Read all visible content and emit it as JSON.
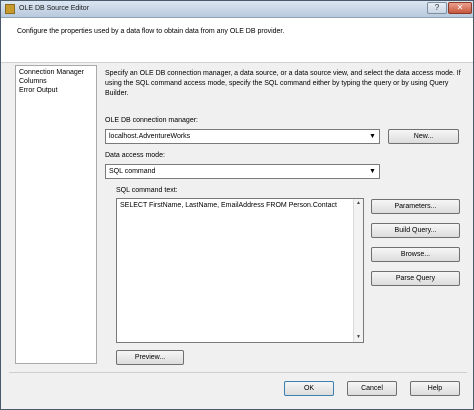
{
  "window": {
    "title": "OLE DB Source Editor",
    "help_glyph": "?",
    "close_glyph": "✕"
  },
  "header": {
    "description": "Configure the properties used by a data flow to obtain data from any OLE DB provider."
  },
  "nav": {
    "items": [
      "Connection Manager",
      "Columns",
      "Error Output"
    ]
  },
  "main": {
    "description": "Specify an OLE DB connection manager, a data source, or a data source view, and select the data access mode. If using the SQL command access mode, specify the SQL command either by typing the query or by using Query Builder.",
    "connection_label": "OLE DB connection manager:",
    "connection_value": "localhost.AdventureWorks",
    "access_mode_label": "Data access mode:",
    "access_mode_value": "SQL command",
    "sql_label": "SQL command text:",
    "sql_text": "SELECT FirstName, LastName, EmailAddress FROM Person.Contact",
    "dropdown_glyph": "▼"
  },
  "buttons": {
    "new": "New...",
    "parameters": "Parameters...",
    "build_query": "Build Query...",
    "browse": "Browse...",
    "parse_query": "Parse Query",
    "preview": "Preview...",
    "ok": "OK",
    "cancel": "Cancel",
    "help": "Help"
  }
}
